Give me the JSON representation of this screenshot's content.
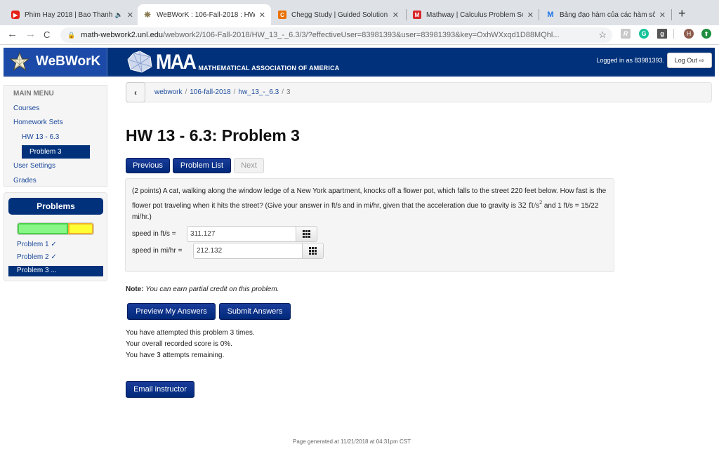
{
  "browser": {
    "tabs": [
      {
        "title": "Phim Hay 2018 | Bao Thanh",
        "icon": "youtube-icon",
        "muted_indicator": "🔈",
        "active": false
      },
      {
        "title": "WeBWorK : 106-Fall-2018 : HW",
        "icon": "webwork-icon",
        "active": true
      },
      {
        "title": "Chegg Study | Guided Solution",
        "icon": "chegg-icon",
        "active": false
      },
      {
        "title": "Mathway | Calculus Problem Sol",
        "icon": "mathway-icon",
        "active": false
      },
      {
        "title": "Bảng đạo hàm của các hàm số",
        "icon": "m-icon",
        "active": false
      }
    ],
    "close_glyph": "✕",
    "new_tab_glyph": "+",
    "url_host": "math-webwork2.unl.edu",
    "url_path": "/webwork2/106-Fall-2018/HW_13_-_6.3/3/?effectiveUser=83981393&user=83981393&key=OxhWXxqd1D88MQhl...",
    "back_glyph": "←",
    "forward_glyph": "→",
    "reload_glyph": "C",
    "lock_glyph": "🔒",
    "star_glyph": "☆",
    "extensions": [
      {
        "name": "r-extension",
        "label": "R",
        "color": "#c8c8c8"
      },
      {
        "name": "grammarly-extension",
        "label": "G",
        "color": "#15c39a"
      },
      {
        "name": "g-extension",
        "label": "g",
        "color": "#555555"
      },
      {
        "name": "profile-avatar",
        "label": "H",
        "color": "#8d5b4c"
      },
      {
        "name": "update-extension",
        "label": "⬆",
        "color": "#1e8e3e"
      }
    ]
  },
  "header": {
    "logo_text": "WeBWorK",
    "maa_short": "MAA",
    "maa_full": "MATHEMATICAL ASSOCIATION OF AMERICA",
    "logged_in_text": "Logged in as 83981393.",
    "logout_label": "Log Out",
    "logout_glyph": "⇨",
    "colors": {
      "header_bg": "#00317a",
      "logo_bg": "#1b4aa8"
    }
  },
  "sidebar": {
    "main_menu_title": "MAIN MENU",
    "items": [
      {
        "label": "Courses"
      },
      {
        "label": "Homework Sets"
      },
      {
        "label": "HW 13 - 6.3"
      },
      {
        "label": "Problem 3",
        "active": true
      },
      {
        "label": "User Settings"
      },
      {
        "label": "Grades"
      }
    ],
    "problems_title": "Problems",
    "progress": {
      "correct_fraction": 0.667,
      "incomplete_fraction": 0.333
    },
    "problems": [
      {
        "label": "Problem 1 ✓"
      },
      {
        "label": "Problem 2 ✓"
      },
      {
        "label": "Problem 3 ...",
        "active": true
      }
    ]
  },
  "breadcrumb": {
    "back_glyph": "‹",
    "parts": [
      "webwork",
      "106-fall-2018",
      "hw_13_-_6.3"
    ],
    "current": "3",
    "separator": "/"
  },
  "main": {
    "title": "HW 13 - 6.3: Problem 3",
    "nav": {
      "previous": "Previous",
      "problem_list": "Problem List",
      "next": "Next"
    },
    "problem": {
      "text_1": "(2 points) A cat, walking along the window ledge of a New York apartment, knocks off a flower pot, which falls to the street 220 feet below. How fast is the flower pot traveling when it hits the street? (Give your answer in ft/s and in mi/hr, given that the acceleration due to gravity is ",
      "math_gravity": "32 ft/s",
      "math_exp": "2",
      "text_2": " and 1 ft/s = 15/22 mi/hr.)",
      "answers": [
        {
          "label": "speed in ft/s =",
          "value": "311.127"
        },
        {
          "label": "speed in mi/hr =",
          "value": "212.132"
        }
      ]
    },
    "note_label": "Note:",
    "note_text": "You can earn partial credit on this problem.",
    "preview_label": "Preview My Answers",
    "submit_label": "Submit Answers",
    "status_lines": [
      "You have attempted this problem 3 times.",
      "Your overall recorded score is 0%.",
      "You have 3 attempts remaining."
    ],
    "email_label": "Email instructor"
  },
  "footer": {
    "text": "Page generated at 11/21/2018 at 04:31pm CST"
  }
}
